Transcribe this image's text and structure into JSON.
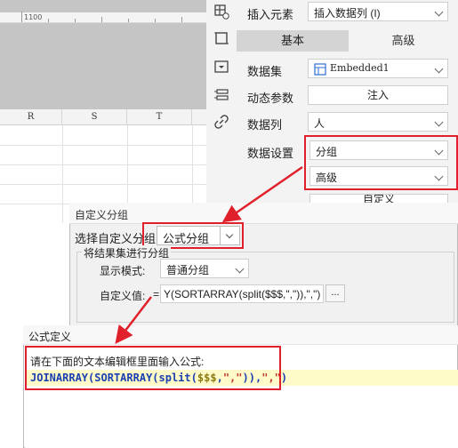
{
  "ruler": {
    "label": "1100"
  },
  "columns": [
    "R",
    "S",
    "T"
  ],
  "panel": {
    "insert_element_label": "插入元素",
    "insert_element_value": "插入数据列 (I)",
    "tabs": [
      "基本",
      "高级"
    ],
    "dataset_label": "数据集",
    "dataset_value": "Embedded1",
    "dynamic_param_label": "动态参数",
    "inject_button": "注入",
    "data_column_label": "数据列",
    "data_column_value": "人",
    "data_setting_label": "数据设置",
    "data_setting_value": "分组",
    "data_setting_mode": "高级",
    "custom_button_partial": "自定义"
  },
  "dialog1": {
    "title": "自定义分组",
    "select_label": "选择自定义分组:",
    "select_value": "公式分组",
    "group_legend": "将结果集进行分组",
    "display_mode_label": "显示模式:",
    "display_mode_value": "普通分组",
    "custom_value_label": "自定义值:",
    "custom_value_prefix": "=",
    "custom_value_text": "Y(SORTARRAY(split($$$,\",\")),\",\")",
    "ellipsis_button": "..."
  },
  "dialog2": {
    "title": "公式定义",
    "prompt": "请在下面的文本编辑框里面输入公式:",
    "formula_tokens": [
      {
        "text": "JOINARRAY",
        "color": "#1a3fb0"
      },
      {
        "text": "(",
        "color": "#1a3fb0"
      },
      {
        "text": "SORTARRAY",
        "color": "#1a3fb0"
      },
      {
        "text": "(",
        "color": "#1a3fb0"
      },
      {
        "text": "split",
        "color": "#1a3fb0"
      },
      {
        "text": "(",
        "color": "#1a3fb0"
      },
      {
        "text": "$$$",
        "color": "#8a7a10"
      },
      {
        "text": ",",
        "color": "#1a3fb0"
      },
      {
        "text": "\",\"",
        "color": "#c0392b"
      },
      {
        "text": "))",
        "color": "#1a3fb0"
      },
      {
        "text": ",",
        "color": "#1a3fb0"
      },
      {
        "text": "\",\"",
        "color": "#c0392b"
      },
      {
        "text": ")",
        "color": "#1a3fb0"
      }
    ]
  },
  "colors": {
    "annotation_red": "#e0202a",
    "selected_tab": "#d4d4d4"
  }
}
